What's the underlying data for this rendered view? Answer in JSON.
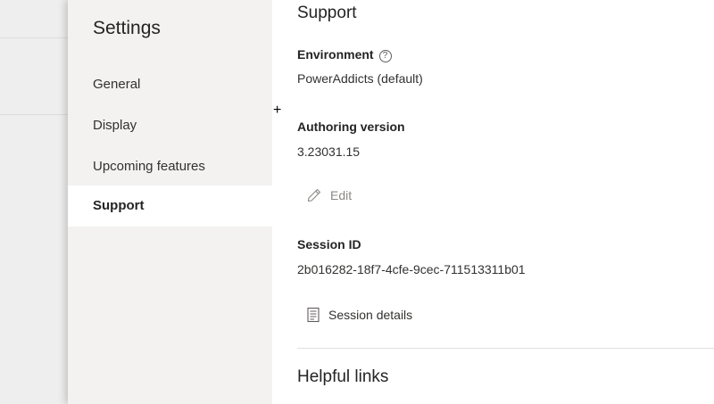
{
  "settings_nav": {
    "title": "Settings",
    "items": [
      {
        "label": "General",
        "selected": false
      },
      {
        "label": "Display",
        "selected": false
      },
      {
        "label": "Upcoming features",
        "selected": false
      },
      {
        "label": "Support",
        "selected": true
      }
    ]
  },
  "support": {
    "title": "Support",
    "environment": {
      "label": "Environment",
      "help_icon": "?",
      "value": "PowerAddicts (default)"
    },
    "authoring_version": {
      "label": "Authoring version",
      "value": "3.23031.15",
      "edit_label": "Edit",
      "edit_icon": "pencil-icon"
    },
    "session": {
      "label": "Session ID",
      "value": "2b016282-18f7-4cfe-9cec-711513311b01",
      "details_label": "Session details",
      "details_icon": "document-icon"
    },
    "helpful_links_title": "Helpful links"
  },
  "colors": {
    "nav_background": "#f3f2f1",
    "selected_background": "#ffffff",
    "backdrop": "#eeeeee",
    "text": "#242424",
    "disabled_text": "#8a8886"
  }
}
